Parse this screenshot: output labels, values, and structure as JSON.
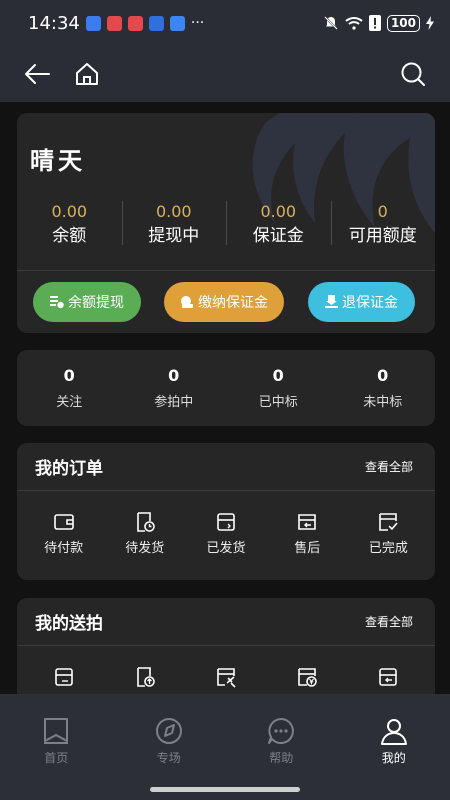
{
  "status_bar": {
    "time": "14:34",
    "battery": "100"
  },
  "user": {
    "name": "晴天"
  },
  "wallet": {
    "stats": [
      {
        "value": "0.00",
        "label": "余额"
      },
      {
        "value": "0.00",
        "label": "提现中"
      },
      {
        "value": "0.00",
        "label": "保证金"
      },
      {
        "value": "0",
        "label": "可用额度"
      }
    ],
    "buttons": {
      "withdraw": "余额提现",
      "pay_deposit": "缴纳保证金",
      "refund_deposit": "退保证金"
    },
    "colors": {
      "value": "#d9b15e",
      "green": "#5aac55",
      "orange": "#e0a039",
      "cyan": "#3fbfdf"
    }
  },
  "activity": [
    {
      "value": "0",
      "label": "关注"
    },
    {
      "value": "0",
      "label": "参拍中"
    },
    {
      "value": "0",
      "label": "已中标"
    },
    {
      "value": "0",
      "label": "未中标"
    }
  ],
  "orders": {
    "title": "我的订单",
    "view_all": "查看全部",
    "items": [
      {
        "label": "待付款",
        "icon": "wallet-icon"
      },
      {
        "label": "待发货",
        "icon": "clock-document-icon"
      },
      {
        "label": "已发货",
        "icon": "box-icon"
      },
      {
        "label": "售后",
        "icon": "refund-icon"
      },
      {
        "label": "已完成",
        "icon": "check-document-icon"
      }
    ]
  },
  "consign": {
    "title": "我的送拍",
    "view_all": "查看全部",
    "items": [
      {
        "icon": "box-icon"
      },
      {
        "icon": "upload-document-icon"
      },
      {
        "icon": "gavel-document-icon"
      },
      {
        "icon": "yuan-document-icon"
      },
      {
        "icon": "return-box-icon"
      }
    ]
  },
  "tabs": [
    {
      "label": "首页",
      "icon": "bookmark-icon"
    },
    {
      "label": "专场",
      "icon": "compass-icon"
    },
    {
      "label": "帮助",
      "icon": "chat-icon"
    },
    {
      "label": "我的",
      "icon": "person-icon",
      "active": true
    }
  ]
}
